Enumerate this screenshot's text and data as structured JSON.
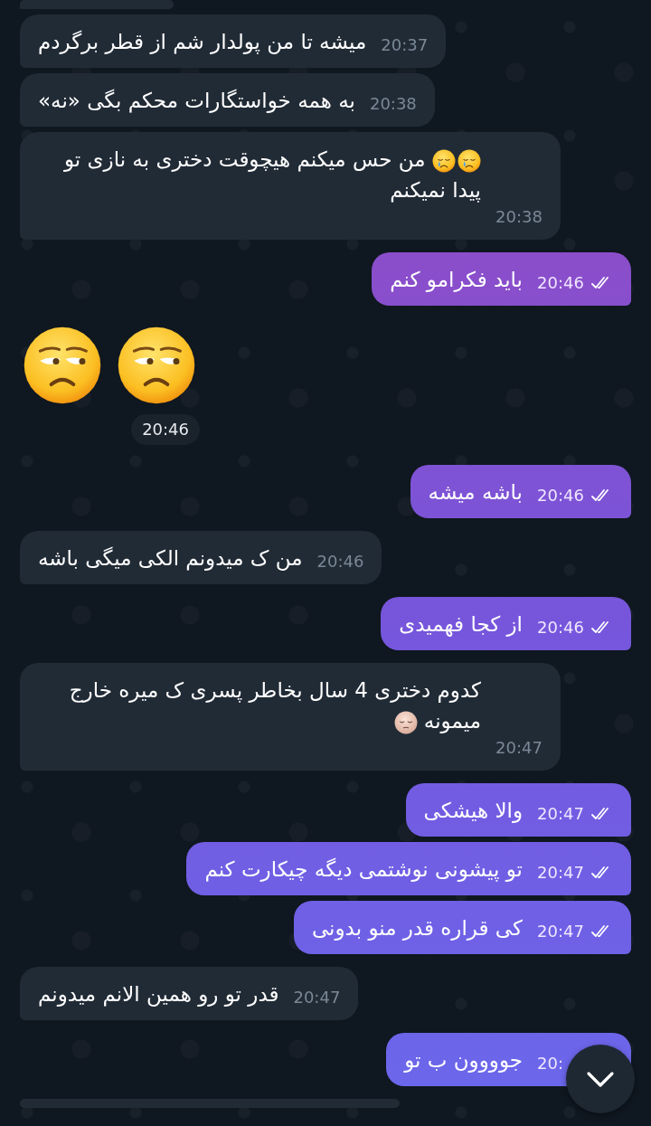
{
  "messages": [
    {
      "kind": "partial",
      "incoming": true
    },
    {
      "kind": "text",
      "incoming": true,
      "text": "میشه تا من پولدار شم از قطر برگردم",
      "time": "20:37"
    },
    {
      "kind": "text",
      "incoming": true,
      "text": "به همه خواستگارات محکم بگی  «نه»",
      "time": "20:38"
    },
    {
      "kind": "text",
      "incoming": true,
      "text": "من حس میکنم هیچوقت دختری به نازی تو پیدا نمیکنم",
      "time": "20:38",
      "emoji_first": true,
      "emoji": [
        {
          "kind": "crying"
        },
        {
          "kind": "crying"
        }
      ]
    },
    {
      "kind": "text",
      "incoming": false,
      "text": "باید فکرامو کنم",
      "time": "20:46",
      "read": true
    },
    {
      "kind": "sticker",
      "emoji": [
        {
          "kind": "unamused"
        },
        {
          "kind": "unamused"
        }
      ],
      "time": "20:46"
    },
    {
      "kind": "text",
      "incoming": false,
      "text": "باشه میشه",
      "time": "20:46",
      "read": true
    },
    {
      "kind": "text",
      "incoming": true,
      "text": "من ک میدونم الکی میگی باشه",
      "time": "20:46"
    },
    {
      "kind": "text",
      "incoming": false,
      "text": "از کجا فهمیدی",
      "time": "20:46",
      "read": true
    },
    {
      "kind": "text",
      "incoming": true,
      "text": "کدوم دختری 4 سال بخاطر پسری ک میره خارج میمونه",
      "time": "20:47",
      "emoji_first": false,
      "emoji": [
        {
          "kind": "pensive"
        }
      ]
    },
    {
      "kind": "text",
      "incoming": false,
      "text": "والا هیشکی",
      "time": "20:47",
      "read": true
    },
    {
      "kind": "text",
      "incoming": false,
      "text": "تو پیشونی نوشتمی دیگه چیکارت کنم",
      "time": "20:47",
      "read": true
    },
    {
      "kind": "text",
      "incoming": false,
      "text": "کی قراره قدر منو بدونی",
      "time": "20:47",
      "read": true
    },
    {
      "kind": "text",
      "incoming": true,
      "text": "قدر تو رو همین الانم میدونم",
      "time": "20:47"
    },
    {
      "kind": "text",
      "incoming": false,
      "text": "جوووون ب تو",
      "time": "20:"
    },
    {
      "kind": "partial",
      "incoming": true
    }
  ]
}
